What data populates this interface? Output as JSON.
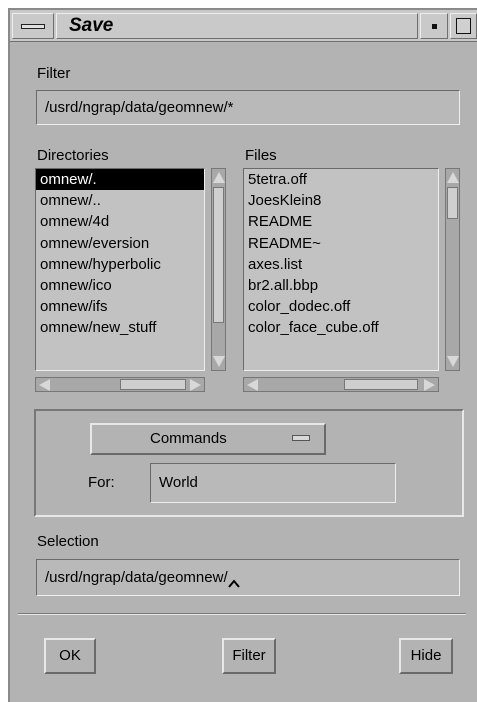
{
  "window": {
    "title": "Save"
  },
  "filter": {
    "label": "Filter",
    "value": "/usrd/ngrap/data/geomnew/*"
  },
  "directories": {
    "label": "Directories",
    "items": [
      "omnew/.",
      "omnew/..",
      "omnew/4d",
      "omnew/eversion",
      "omnew/hyperbolic",
      "omnew/ico",
      "omnew/ifs",
      "omnew/new_stuff"
    ],
    "selected_index": 0
  },
  "files": {
    "label": "Files",
    "items": [
      "5tetra.off",
      "JoesKlein8",
      "README",
      "README~",
      "axes.list",
      "br2.all.bbp",
      "color_dodec.off",
      "color_face_cube.off"
    ]
  },
  "commands": {
    "label": "Commands",
    "for_label": "For:",
    "for_value": "World"
  },
  "selection": {
    "label": "Selection",
    "value": "/usrd/ngrap/data/geomnew/"
  },
  "buttons": {
    "ok": "OK",
    "filter": "Filter",
    "hide": "Hide"
  },
  "icons": {
    "window_menu": "window-menu-icon",
    "minimize": "minimize-icon",
    "maximize": "maximize-icon",
    "option_menu": "option-menu-indicator-icon",
    "text_caret": "text-caret-icon"
  },
  "colors": {
    "background": "#b3b3b3",
    "selected_row": "#000000",
    "selected_text": "#ffffff"
  }
}
